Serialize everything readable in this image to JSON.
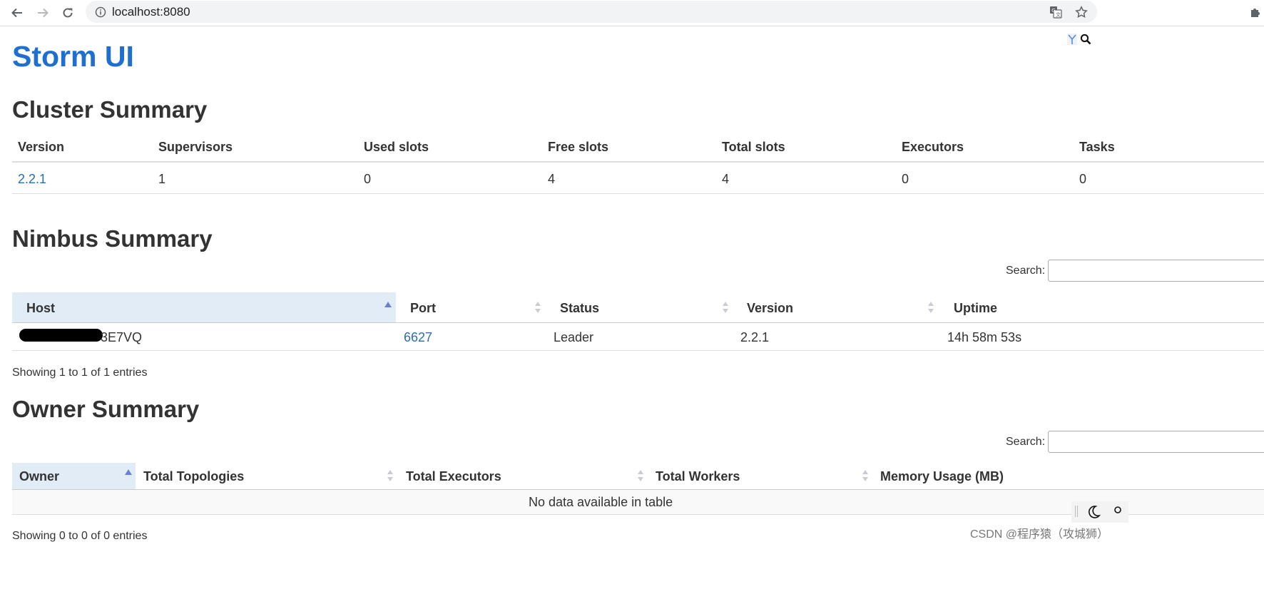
{
  "browser": {
    "url": "localhost:8080"
  },
  "page": {
    "title": "Storm UI"
  },
  "cluster": {
    "heading": "Cluster Summary",
    "columns": [
      "Version",
      "Supervisors",
      "Used slots",
      "Free slots",
      "Total slots",
      "Executors",
      "Tasks"
    ],
    "row": [
      "2.2.1",
      "1",
      "0",
      "4",
      "4",
      "0",
      "0"
    ]
  },
  "nimbus": {
    "heading": "Nimbus Summary",
    "search_label": "Search:",
    "columns": [
      "Host",
      "Port",
      "Status",
      "Version",
      "Uptime"
    ],
    "row": {
      "host": "3E7VQ",
      "port": "6627",
      "status": "Leader",
      "version": "2.2.1",
      "uptime": "14h 58m 53s"
    },
    "info": "Showing 1 to 1 of 1 entries"
  },
  "owner": {
    "heading": "Owner Summary",
    "search_label": "Search:",
    "columns": [
      "Owner",
      "Total Topologies",
      "Total Executors",
      "Total Workers",
      "Memory Usage (MB)"
    ],
    "empty": "No data available in table",
    "info": "Showing 0 to 0 of 0 entries"
  },
  "watermark": "CSDN @程序猿（攻城狮）",
  "colors": {
    "title_blue": "#1f6fd0",
    "link_blue": "#2a6ebb",
    "sorted_header_bg": "#e1ecf6",
    "sort_active": "#6a7fd6",
    "sort_inactive": "#c9ccd6"
  },
  "icons": [
    "back-arrow-icon",
    "forward-arrow-icon",
    "reload-icon",
    "info-icon",
    "translate-icon",
    "star-icon",
    "puzzle-icon",
    "y-logo-icon",
    "magnifier-icon",
    "moon-icon"
  ]
}
